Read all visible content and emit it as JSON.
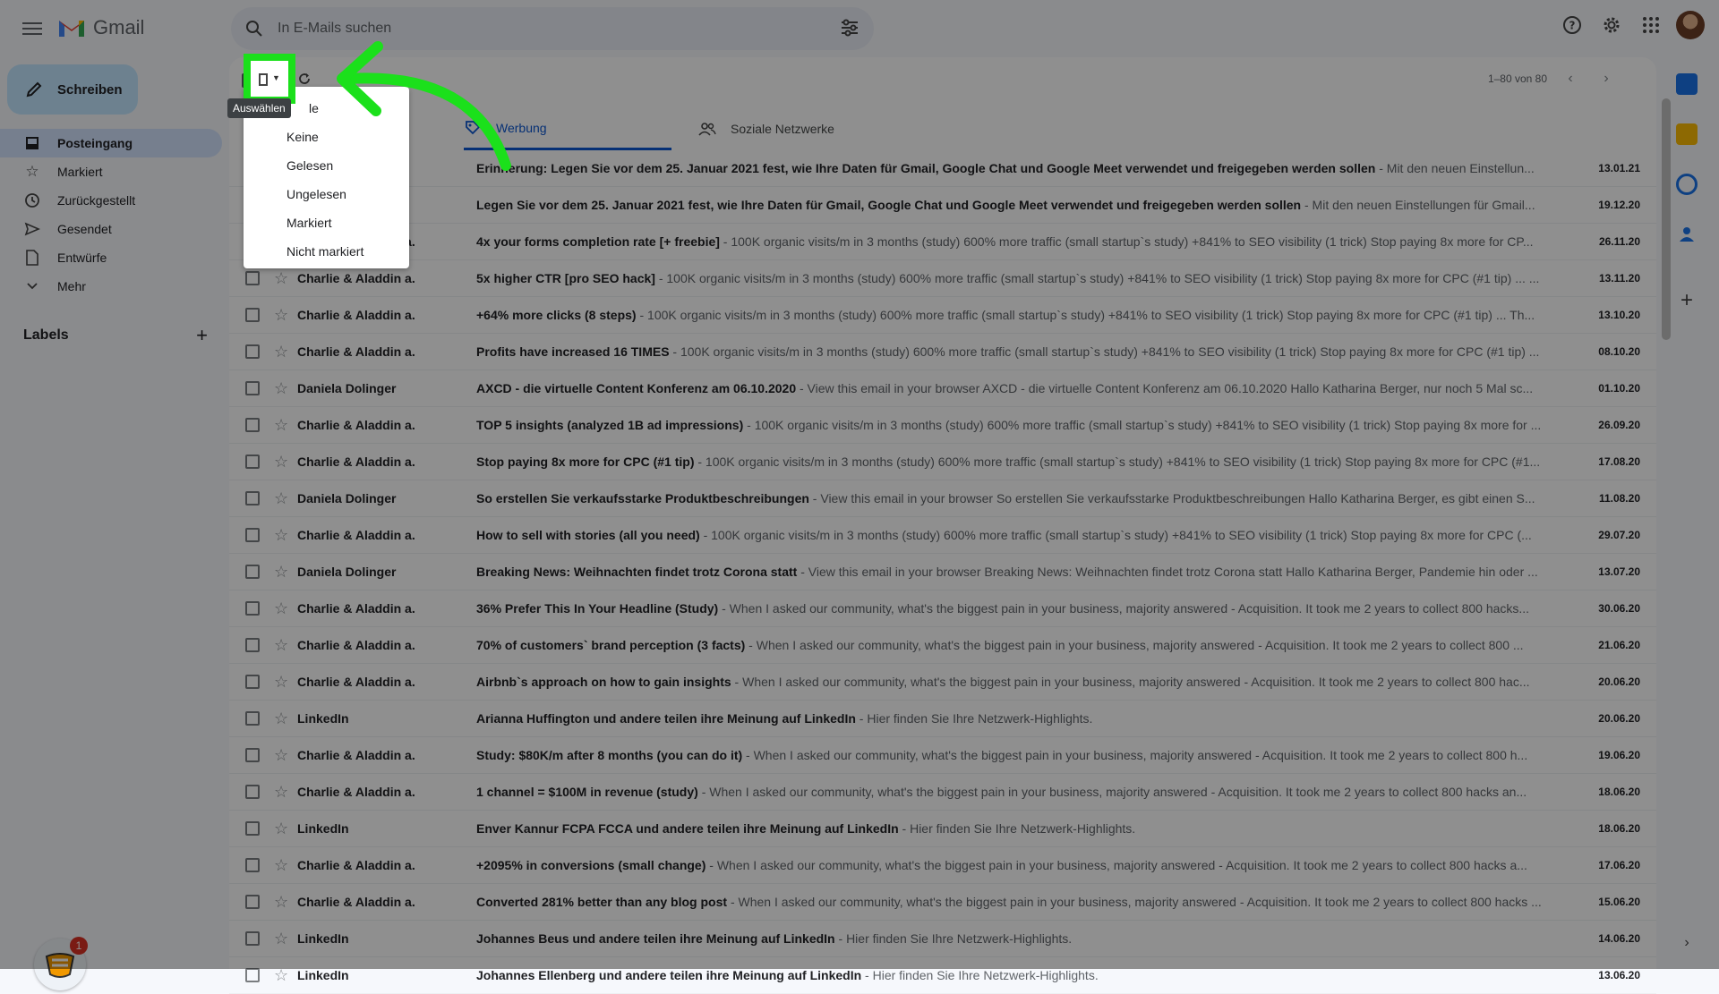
{
  "app": {
    "name": "Gmail"
  },
  "search": {
    "placeholder": "In E-Mails suchen"
  },
  "compose": {
    "label": "Schreiben"
  },
  "nav": [
    {
      "label": "Posteingang",
      "icon": "inbox-icon",
      "active": true
    },
    {
      "label": "Markiert",
      "icon": "star-icon"
    },
    {
      "label": "Zurückgestellt",
      "icon": "clock-icon"
    },
    {
      "label": "Gesendet",
      "icon": "send-icon"
    },
    {
      "label": "Entwürfe",
      "icon": "draft-icon"
    },
    {
      "label": "Mehr",
      "icon": "chevron-down-icon"
    }
  ],
  "labels": {
    "title": "Labels",
    "add": "+"
  },
  "extension": {
    "badge": "1"
  },
  "toolbar": {
    "pager": "1–80 von 80",
    "prev": "‹",
    "next": "›"
  },
  "tabs": [
    {
      "label": "Werbung",
      "icon": "tag-icon",
      "active": true
    },
    {
      "label": "Soziale Netzwerke",
      "icon": "people-icon"
    }
  ],
  "dropdown": {
    "partial_first": "le",
    "items": [
      "Keine",
      "Gelesen",
      "Ungelesen",
      "Markiert",
      "Nicht markiert"
    ]
  },
  "tooltip": "Auswählen",
  "emails": [
    {
      "sender": "",
      "subject": "Erinnerung: Legen Sie vor dem 25. Januar 2021 fest, wie Ihre Daten für Gmail, Google Chat und Google Meet verwendet und freigegeben werden sollen",
      "snippet": " - Mit den neuen Einstellun...",
      "date": "13.01.21"
    },
    {
      "sender": "",
      "subject": "Legen Sie vor dem 25. Januar 2021 fest, wie Ihre Daten für Gmail, Google Chat und Google Meet verwendet und freigegeben werden sollen",
      "snippet": " - Mit den neuen Einstellungen für Gmail...",
      "date": "19.12.20"
    },
    {
      "sender": "Charlie & Aladdin a.",
      "subject": "4x your forms completion rate [+ freebie]",
      "snippet": " - 100K organic visits/m in 3 months (study) 600% more traffic (small startup`s study) +841% to SEO visibility (1 trick) Stop paying 8x more for CP...",
      "date": "26.11.20"
    },
    {
      "sender": "Charlie & Aladdin a.",
      "subject": "5x higher CTR [pro SEO hack]",
      "snippet": " - 100K organic visits/m in 3 months (study) 600% more traffic (small startup`s study) +841% to SEO visibility (1 trick) Stop paying 8x more for CPC (#1 tip) ... ...",
      "date": "13.11.20"
    },
    {
      "sender": "Charlie & Aladdin a.",
      "subject": "+64% more clicks (8 steps)",
      "snippet": " - 100K organic visits/m in 3 months (study) 600% more traffic (small startup`s study) +841% to SEO visibility (1 trick) Stop paying 8x more for CPC (#1 tip) ... Th...",
      "date": "13.10.20"
    },
    {
      "sender": "Charlie & Aladdin a.",
      "subject": "Profits have increased 16 TIMES",
      "snippet": " - 100K organic visits/m in 3 months (study) 600% more traffic (small startup`s study) +841% to SEO visibility (1 trick) Stop paying 8x more for CPC (#1 tip) ...",
      "date": "08.10.20"
    },
    {
      "sender": "Daniela Dolinger",
      "subject": "AXCD - die virtuelle Content Konferenz am 06.10.2020",
      "snippet": " - View this email in your browser AXCD - die virtuelle Content Konferenz am 06.10.2020 Hallo Katharina Berger, nur noch 5 Mal sc...",
      "date": "01.10.20"
    },
    {
      "sender": "Charlie & Aladdin a.",
      "subject": "TOP 5 insights (analyzed 1B ad impressions)",
      "snippet": " - 100K organic visits/m in 3 months (study) 600% more traffic (small startup`s study) +841% to SEO visibility (1 trick) Stop paying 8x more for ...",
      "date": "26.09.20"
    },
    {
      "sender": "Charlie & Aladdin a.",
      "subject": "Stop paying 8x more for CPC (#1 tip)",
      "snippet": " - 100K organic visits/m in 3 months (study) 600% more traffic (small startup`s study) +841% to SEO visibility (1 trick) Stop paying 8x more for CPC (#1...",
      "date": "17.08.20"
    },
    {
      "sender": "Daniela Dolinger",
      "subject": "So erstellen Sie verkaufsstarke Produktbeschreibungen",
      "snippet": " - View this email in your browser So erstellen Sie verkaufsstarke Produktbeschreibungen Hallo Katharina Berger, es gibt einen S...",
      "date": "11.08.20"
    },
    {
      "sender": "Charlie & Aladdin a.",
      "subject": "How to sell with stories (all you need)",
      "snippet": " - 100K organic visits/m in 3 months (study) 600% more traffic (small startup`s study) +841% to SEO visibility (1 trick) Stop paying 8x more for CPC (...",
      "date": "29.07.20"
    },
    {
      "sender": "Daniela Dolinger",
      "subject": "Breaking News: Weihnachten findet trotz Corona statt",
      "snippet": " - View this email in your browser Breaking News: Weihnachten findet trotz Corona statt Hallo Katharina Berger, Pandemie hin oder ...",
      "date": "13.07.20"
    },
    {
      "sender": "Charlie & Aladdin a.",
      "subject": "36% Prefer This In Your Headline (Study)",
      "snippet": " - When I asked our community, what's the biggest pain in your business, majority answered - Acquisition. It took me 2 years to collect 800 hacks...",
      "date": "30.06.20"
    },
    {
      "sender": "Charlie & Aladdin a.",
      "subject": "70% of customers` brand perception (3 facts)",
      "snippet": " - When I asked our community, what's the biggest pain in your business, majority answered - Acquisition. It took me 2 years to collect 800 ...",
      "date": "21.06.20"
    },
    {
      "sender": "Charlie & Aladdin a.",
      "subject": "Airbnb`s approach on how to gain insights",
      "snippet": " - When I asked our community, what's the biggest pain in your business, majority answered - Acquisition. It took me 2 years to collect 800 hac...",
      "date": "20.06.20"
    },
    {
      "sender": "LinkedIn",
      "subject": "Arianna Huffington und andere teilen ihre Meinung auf LinkedIn",
      "snippet": " - Hier finden Sie Ihre Netzwerk-Highlights.",
      "date": "20.06.20"
    },
    {
      "sender": "Charlie & Aladdin a.",
      "subject": "Study: $80K/m after 8 months (you can do it)",
      "snippet": " - When I asked our community, what's the biggest pain in your business, majority answered - Acquisition. It took me 2 years to collect 800 h...",
      "date": "19.06.20"
    },
    {
      "sender": "Charlie & Aladdin a.",
      "subject": "1 channel = $100M in revenue (study)",
      "snippet": " - When I asked our community, what's the biggest pain in your business, majority answered - Acquisition. It took me 2 years to collect 800 hacks an...",
      "date": "18.06.20"
    },
    {
      "sender": "LinkedIn",
      "subject": "Enver Kannur FCPA FCCA und andere teilen ihre Meinung auf LinkedIn",
      "snippet": " - Hier finden Sie Ihre Netzwerk-Highlights.",
      "date": "18.06.20"
    },
    {
      "sender": "Charlie & Aladdin a.",
      "subject": "+2095% in conversions (small change)",
      "snippet": " - When I asked our community, what's the biggest pain in your business, majority answered - Acquisition. It took me 2 years to collect 800 hacks a...",
      "date": "17.06.20"
    },
    {
      "sender": "Charlie & Aladdin a.",
      "subject": "Converted 281% better than any blog post",
      "snippet": " - When I asked our community, what's the biggest pain in your business, majority answered - Acquisition. It took me 2 years to collect 800 hacks ...",
      "date": "15.06.20"
    },
    {
      "sender": "LinkedIn",
      "subject": "Johannes Beus und andere teilen ihre Meinung auf LinkedIn",
      "snippet": " - Hier finden Sie Ihre Netzwerk-Highlights.",
      "date": "14.06.20"
    },
    {
      "sender": "LinkedIn",
      "subject": "Johannes Ellenberg und andere teilen ihre Meinung auf LinkedIn",
      "snippet": " - Hier finden Sie Ihre Netzwerk-Highlights.",
      "date": "13.06.20"
    }
  ],
  "colors": {
    "highlight": "#1be01b",
    "accent": "#0b57d0",
    "compose_bg": "#c2e7ff"
  }
}
